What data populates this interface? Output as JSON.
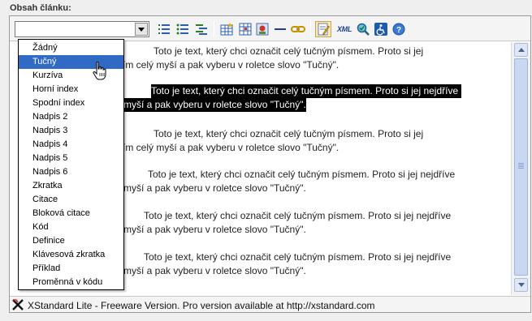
{
  "field_label": "Obsah článku:",
  "toolbar": {
    "format_select_value": "",
    "icons": [
      "numbered-list-icon",
      "bulleted-list-icon",
      "definition-list-icon",
      "insert-table-icon",
      "table-properties-icon",
      "insert-image-icon",
      "horizontal-rule-icon",
      "hyperlink-icon",
      "edit-source-icon",
      "xml-icon",
      "spell-check-icon",
      "accessibility-icon",
      "help-icon"
    ],
    "xml_label": "XML"
  },
  "dropdown": {
    "items": [
      "Žádný",
      "Tučný",
      "Kurzíva",
      "Horní index",
      "Spodní index",
      "Nadpis 2",
      "Nadpis 3",
      "Nadpis 4",
      "Nadpis 5",
      "Nadpis 6",
      "Zkratka",
      "Citace",
      "Bloková citace",
      "Kód",
      "Definice",
      "Klávesová zkratka",
      "Příklad",
      "Proměnná v kódu"
    ],
    "highlighted_index": 1
  },
  "content": {
    "paragraphs": [
      {
        "line1": "Toto je text, který chci označit celý tučným písmem. Proto si jej",
        "line2": "ším celý myší a pak vyberu v roletce slovo \"Tučný\"."
      },
      {
        "line1": "Toto je text, který chci označit celý tučným písmem. Proto si jej nejdříve",
        "line2": "myší a pak vyberu v roletce slovo \"Tučný\"."
      },
      {
        "line1": "Toto je text, který chci označit celý tučným písmem. Proto si jej",
        "line2": "ším celý myší a pak vyberu v roletce slovo \"Tučný\"."
      },
      {
        "line1": "Toto je text, který chci označit celý tučným písmem. Proto si jej nejdříve",
        "line2": "myší a pak vyberu v roletce slovo \"Tučný\"."
      },
      {
        "line1": "Toto je text, který chci označit celý tučným písmem. Proto si jej nejdříve",
        "line2": "myší a pak vyberu v roletce slovo \"Tučný\"."
      },
      {
        "line1": "Toto je text, který chci označit celý tučným písmem. Proto si jej nejdříve",
        "line2": "myší a pak vyberu v roletce slovo \"Tučný\"."
      }
    ],
    "selected_paragraph_index": 1
  },
  "status_bar": {
    "text": "XStandard Lite - Freeware Version.  Pro version available at http://xstandard.com"
  },
  "colors": {
    "highlight": "#316ac5",
    "selection": "#000000"
  }
}
